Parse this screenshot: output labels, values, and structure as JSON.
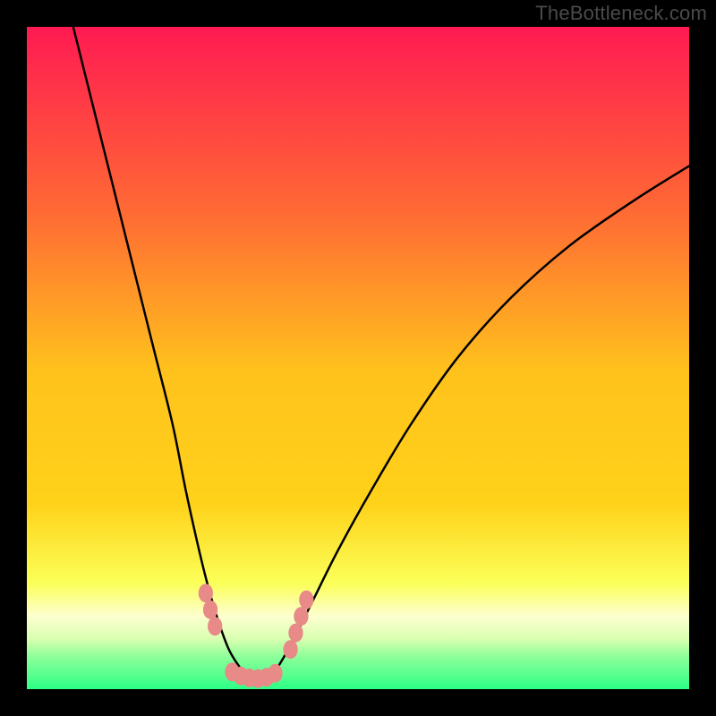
{
  "watermark": "TheBottleneck.com",
  "colors": {
    "bg": "#000000",
    "grad_top": "#ff1a52",
    "grad_mid_upper": "#ff7a2e",
    "grad_mid": "#ffd21a",
    "grad_lower": "#f8ff54",
    "grad_band": "#fdffcf",
    "grad_green1": "#b7ff7a",
    "grad_green2": "#2dff86",
    "curve": "#000000",
    "marker_fill": "#e78a88",
    "marker_stroke": "#c96a68"
  },
  "chart_data": {
    "type": "line",
    "title": "",
    "xlabel": "",
    "ylabel": "",
    "xlim": [
      0,
      100
    ],
    "ylim": [
      0,
      100
    ],
    "series": [
      {
        "name": "bottleneck-curve",
        "x": [
          7,
          10,
          13,
          16,
          19,
          22,
          24,
          26,
          27.5,
          29,
          30.5,
          32,
          33,
          34,
          35,
          36,
          37,
          38,
          40,
          43,
          47,
          52,
          58,
          65,
          73,
          82,
          92,
          100
        ],
        "y": [
          100,
          88,
          76,
          64,
          52,
          40,
          30,
          21,
          15,
          10,
          6,
          3.5,
          2.2,
          1.6,
          1.4,
          1.6,
          2.2,
          3.5,
          7,
          13,
          21,
          30,
          40,
          50,
          59,
          67,
          74,
          79
        ]
      }
    ],
    "markers": [
      {
        "x": 27.0,
        "y": 14.5
      },
      {
        "x": 27.7,
        "y": 12.0
      },
      {
        "x": 28.4,
        "y": 9.5
      },
      {
        "x": 31.0,
        "y": 2.6
      },
      {
        "x": 32.3,
        "y": 2.0
      },
      {
        "x": 33.6,
        "y": 1.7
      },
      {
        "x": 34.9,
        "y": 1.6
      },
      {
        "x": 36.2,
        "y": 1.8
      },
      {
        "x": 37.5,
        "y": 2.4
      },
      {
        "x": 39.8,
        "y": 6.0
      },
      {
        "x": 40.6,
        "y": 8.5
      },
      {
        "x": 41.4,
        "y": 11.0
      },
      {
        "x": 42.2,
        "y": 13.5
      }
    ]
  }
}
